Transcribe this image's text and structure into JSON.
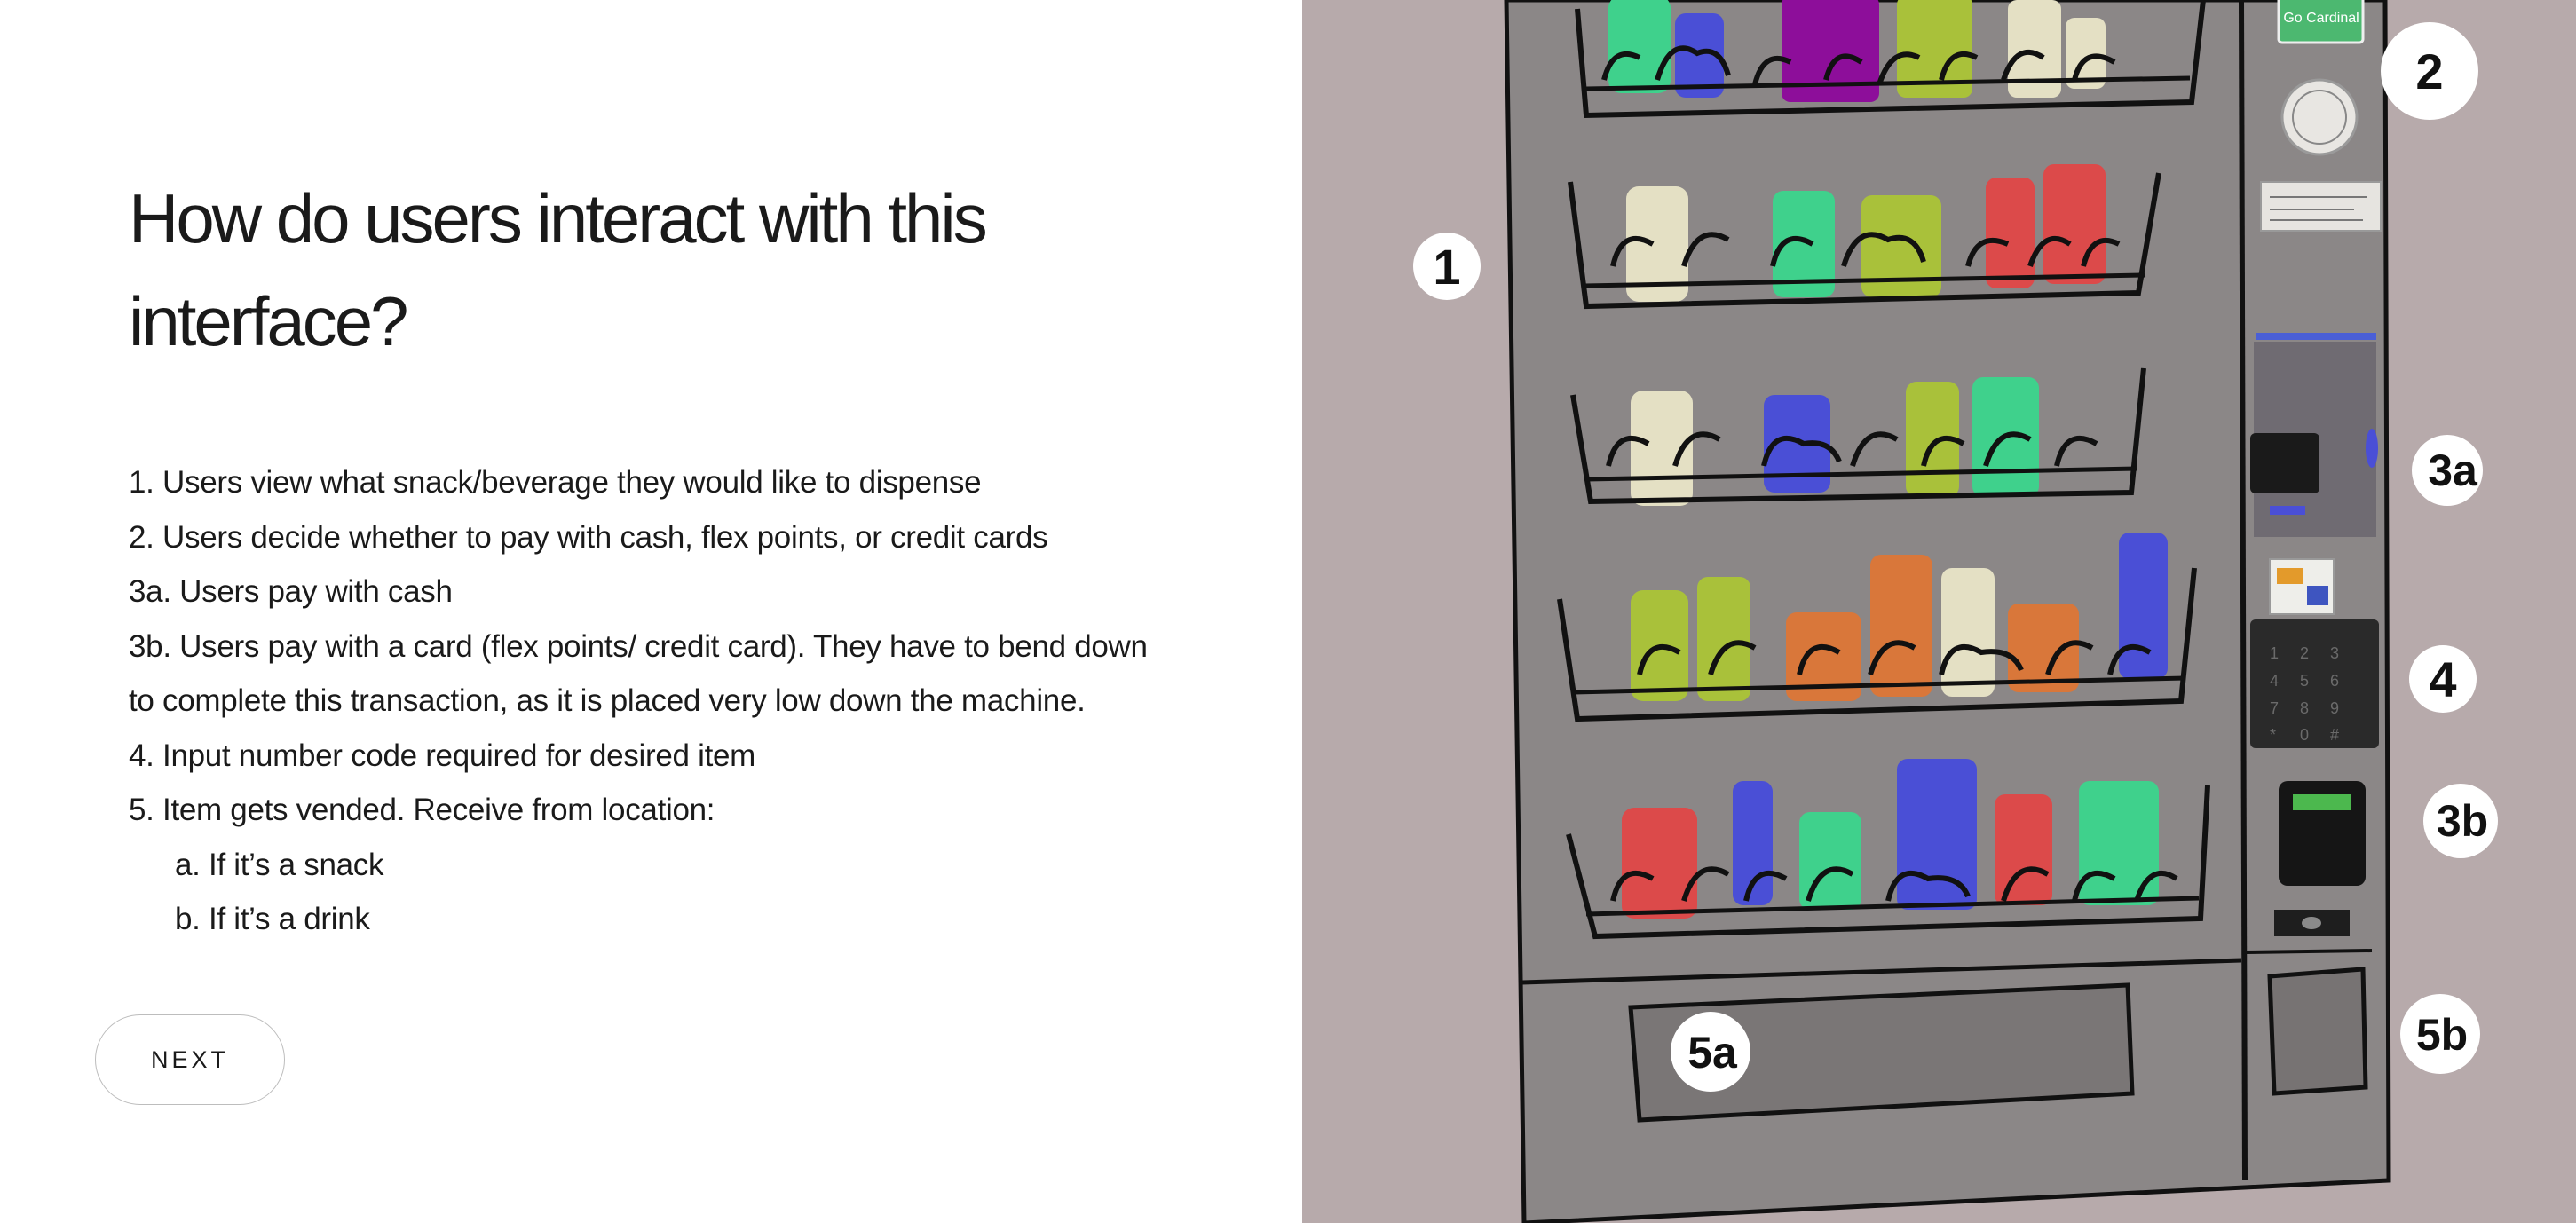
{
  "title": "How do users interact with this interface?",
  "steps": [
    "1. Users view what snack/beverage they would like to dispense",
    "2. Users decide whether to pay with cash, flex points, or credit cards",
    "3a. Users pay with cash",
    "3b. Users pay with a card (flex points/ credit card). They have to bend down to complete this transaction, as it is placed very low down the machine.",
    "4. Input number code required for desired item",
    "5. Item gets vended. Receive from location:",
    "a. If it’s a snack",
    "b. If it’s a drink"
  ],
  "next_label": "NEXT",
  "illustration": {
    "callouts": [
      "1",
      "2",
      "3a",
      "4",
      "3b",
      "5a",
      "5b"
    ],
    "sticker_text": "Go Cardinal",
    "keypad_keys": [
      "1",
      "2",
      "3",
      "4",
      "5",
      "6",
      "7",
      "8",
      "9",
      "*",
      "0",
      "#"
    ],
    "colors": {
      "background": "#b7aaab",
      "machine_body": "#8c8888",
      "green": "#3fd18c",
      "blue": "#4a4fd6",
      "purple": "#8d0e9a",
      "lime": "#a9c13a",
      "cream": "#e4e0c4",
      "red": "#dc4a4a",
      "orange": "#d9773a",
      "outline": "#111111"
    }
  }
}
